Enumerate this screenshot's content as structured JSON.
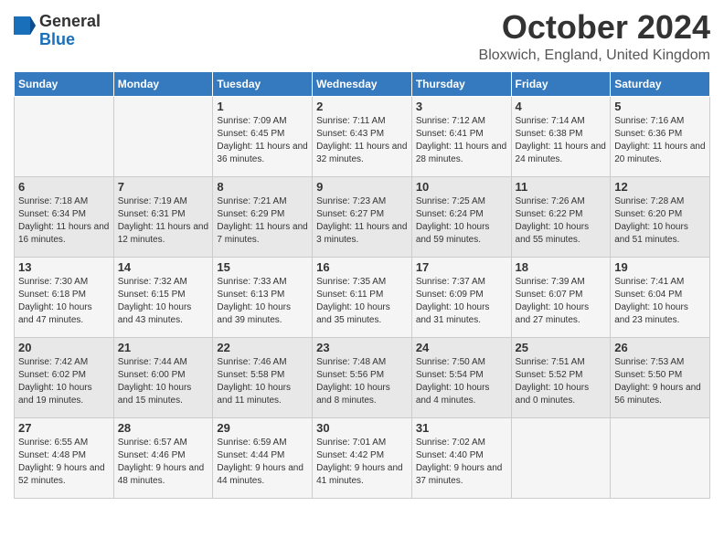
{
  "header": {
    "logo_general": "General",
    "logo_blue": "Blue",
    "month_title": "October 2024",
    "location": "Bloxwich, England, United Kingdom"
  },
  "days_of_week": [
    "Sunday",
    "Monday",
    "Tuesday",
    "Wednesday",
    "Thursday",
    "Friday",
    "Saturday"
  ],
  "weeks": [
    [
      {
        "day": "",
        "info": ""
      },
      {
        "day": "",
        "info": ""
      },
      {
        "day": "1",
        "info": "Sunrise: 7:09 AM\nSunset: 6:45 PM\nDaylight: 11 hours and 36 minutes."
      },
      {
        "day": "2",
        "info": "Sunrise: 7:11 AM\nSunset: 6:43 PM\nDaylight: 11 hours and 32 minutes."
      },
      {
        "day": "3",
        "info": "Sunrise: 7:12 AM\nSunset: 6:41 PM\nDaylight: 11 hours and 28 minutes."
      },
      {
        "day": "4",
        "info": "Sunrise: 7:14 AM\nSunset: 6:38 PM\nDaylight: 11 hours and 24 minutes."
      },
      {
        "day": "5",
        "info": "Sunrise: 7:16 AM\nSunset: 6:36 PM\nDaylight: 11 hours and 20 minutes."
      }
    ],
    [
      {
        "day": "6",
        "info": "Sunrise: 7:18 AM\nSunset: 6:34 PM\nDaylight: 11 hours and 16 minutes."
      },
      {
        "day": "7",
        "info": "Sunrise: 7:19 AM\nSunset: 6:31 PM\nDaylight: 11 hours and 12 minutes."
      },
      {
        "day": "8",
        "info": "Sunrise: 7:21 AM\nSunset: 6:29 PM\nDaylight: 11 hours and 7 minutes."
      },
      {
        "day": "9",
        "info": "Sunrise: 7:23 AM\nSunset: 6:27 PM\nDaylight: 11 hours and 3 minutes."
      },
      {
        "day": "10",
        "info": "Sunrise: 7:25 AM\nSunset: 6:24 PM\nDaylight: 10 hours and 59 minutes."
      },
      {
        "day": "11",
        "info": "Sunrise: 7:26 AM\nSunset: 6:22 PM\nDaylight: 10 hours and 55 minutes."
      },
      {
        "day": "12",
        "info": "Sunrise: 7:28 AM\nSunset: 6:20 PM\nDaylight: 10 hours and 51 minutes."
      }
    ],
    [
      {
        "day": "13",
        "info": "Sunrise: 7:30 AM\nSunset: 6:18 PM\nDaylight: 10 hours and 47 minutes."
      },
      {
        "day": "14",
        "info": "Sunrise: 7:32 AM\nSunset: 6:15 PM\nDaylight: 10 hours and 43 minutes."
      },
      {
        "day": "15",
        "info": "Sunrise: 7:33 AM\nSunset: 6:13 PM\nDaylight: 10 hours and 39 minutes."
      },
      {
        "day": "16",
        "info": "Sunrise: 7:35 AM\nSunset: 6:11 PM\nDaylight: 10 hours and 35 minutes."
      },
      {
        "day": "17",
        "info": "Sunrise: 7:37 AM\nSunset: 6:09 PM\nDaylight: 10 hours and 31 minutes."
      },
      {
        "day": "18",
        "info": "Sunrise: 7:39 AM\nSunset: 6:07 PM\nDaylight: 10 hours and 27 minutes."
      },
      {
        "day": "19",
        "info": "Sunrise: 7:41 AM\nSunset: 6:04 PM\nDaylight: 10 hours and 23 minutes."
      }
    ],
    [
      {
        "day": "20",
        "info": "Sunrise: 7:42 AM\nSunset: 6:02 PM\nDaylight: 10 hours and 19 minutes."
      },
      {
        "day": "21",
        "info": "Sunrise: 7:44 AM\nSunset: 6:00 PM\nDaylight: 10 hours and 15 minutes."
      },
      {
        "day": "22",
        "info": "Sunrise: 7:46 AM\nSunset: 5:58 PM\nDaylight: 10 hours and 11 minutes."
      },
      {
        "day": "23",
        "info": "Sunrise: 7:48 AM\nSunset: 5:56 PM\nDaylight: 10 hours and 8 minutes."
      },
      {
        "day": "24",
        "info": "Sunrise: 7:50 AM\nSunset: 5:54 PM\nDaylight: 10 hours and 4 minutes."
      },
      {
        "day": "25",
        "info": "Sunrise: 7:51 AM\nSunset: 5:52 PM\nDaylight: 10 hours and 0 minutes."
      },
      {
        "day": "26",
        "info": "Sunrise: 7:53 AM\nSunset: 5:50 PM\nDaylight: 9 hours and 56 minutes."
      }
    ],
    [
      {
        "day": "27",
        "info": "Sunrise: 6:55 AM\nSunset: 4:48 PM\nDaylight: 9 hours and 52 minutes."
      },
      {
        "day": "28",
        "info": "Sunrise: 6:57 AM\nSunset: 4:46 PM\nDaylight: 9 hours and 48 minutes."
      },
      {
        "day": "29",
        "info": "Sunrise: 6:59 AM\nSunset: 4:44 PM\nDaylight: 9 hours and 44 minutes."
      },
      {
        "day": "30",
        "info": "Sunrise: 7:01 AM\nSunset: 4:42 PM\nDaylight: 9 hours and 41 minutes."
      },
      {
        "day": "31",
        "info": "Sunrise: 7:02 AM\nSunset: 4:40 PM\nDaylight: 9 hours and 37 minutes."
      },
      {
        "day": "",
        "info": ""
      },
      {
        "day": "",
        "info": ""
      }
    ]
  ]
}
